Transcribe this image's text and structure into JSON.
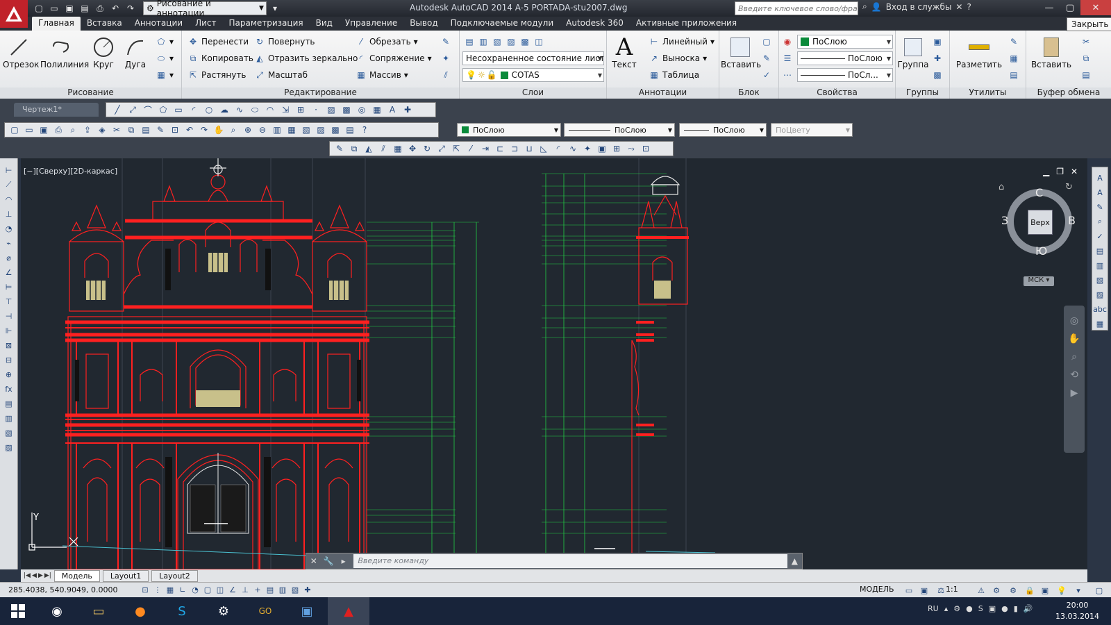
{
  "titlebar": {
    "workspace": "Рисование и аннотации",
    "title": "Autodesk AutoCAD 2014    A-5 PORTADA-stu2007.dwg",
    "search_placeholder": "Введите ключевое слово/фразу",
    "signin": "Вход в службы",
    "close_tooltip": "Закрыть"
  },
  "ribbon_tabs": [
    "Главная",
    "Вставка",
    "Аннотации",
    "Лист",
    "Параметризация",
    "Вид",
    "Управление",
    "Вывод",
    "Подключаемые модули",
    "Autodesk 360",
    "Активные приложения"
  ],
  "ribbon": {
    "draw": {
      "title": "Рисование",
      "line": "Отрезок",
      "polyline": "Полилиния",
      "circle": "Круг",
      "arc": "Дуга"
    },
    "modify": {
      "title": "Редактирование",
      "move": "Перенести",
      "rotate": "Повернуть",
      "trim": "Обрезать",
      "copy": "Копировать",
      "mirror": "Отразить зеркально",
      "fillet": "Сопряжение",
      "stretch": "Растянуть",
      "scale": "Масштаб",
      "array": "Массив"
    },
    "layers": {
      "title": "Слои",
      "state": "Несохраненное состояние листа",
      "layer": "COTAS"
    },
    "annotation": {
      "title": "Аннотации",
      "text": "Текст",
      "linear": "Линейный",
      "leader": "Выноска",
      "table": "Таблица"
    },
    "block": {
      "title": "Блок",
      "insert": "Вставить"
    },
    "properties": {
      "title": "Свойства",
      "color": "ПоСлою",
      "linetype": "ПоСлою",
      "lineweight": "ПоСл..."
    },
    "groups": {
      "title": "Группы",
      "group": "Группа"
    },
    "utilities": {
      "title": "Утилиты",
      "measure": "Разметить"
    },
    "clipboard": {
      "title": "Буфер обмена",
      "paste": "Вставить"
    }
  },
  "doc_tab": "Чертеж1*",
  "props_toolbar": {
    "color": "ПоСлою",
    "linetype": "ПоСлою",
    "lineweight": "ПоСлою",
    "plotstyle": "ПоЦвету"
  },
  "viewport": {
    "label": "[−][Сверху][2D-каркас]",
    "viewcube": {
      "face": "Верх",
      "n": "С",
      "s": "Ю",
      "w": "З",
      "e": "В"
    },
    "ucs": "МСК",
    "ucs_y": "Y"
  },
  "command": {
    "placeholder": "Введите команду"
  },
  "layout_tabs": [
    "Модель",
    "Layout1",
    "Layout2"
  ],
  "status": {
    "coords": "285.4038, 540.9049, 0.0000",
    "model": "МОДЕЛЬ",
    "scale": "1:1"
  },
  "taskbar": {
    "lang": "RU",
    "time": "20:00",
    "date": "13.03.2014"
  },
  "colors": {
    "accent": "#c0222a",
    "drawing_red": "#ff2020",
    "dimension_green": "#22cc44",
    "canvas": "#212830"
  }
}
